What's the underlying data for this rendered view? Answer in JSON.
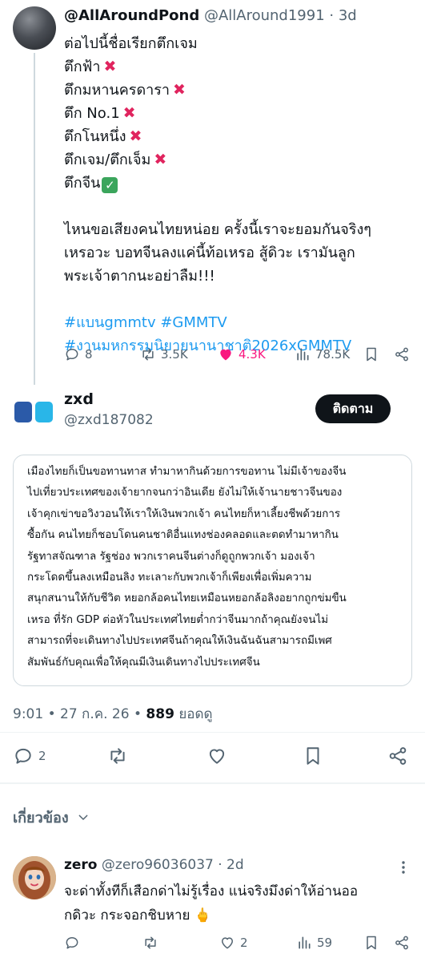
{
  "tweet1": {
    "display_name": "@AllAroundPond",
    "handle": "@AllAround1991",
    "time": "· 3d",
    "lines": [
      {
        "text": "ต่อไปนี้ชื่อเรียกตึกเจม",
        "mark": ""
      },
      {
        "text": "ตึกฟ้า",
        "mark": "x"
      },
      {
        "text": "ตึกมหานครดารา",
        "mark": "x"
      },
      {
        "text": "ตึก No.1",
        "mark": "x"
      },
      {
        "text": "ตึกโนหนึ่ง",
        "mark": "x"
      },
      {
        "text": "ตึกเจม/ตึกเจ็ม",
        "mark": "x"
      },
      {
        "text": "ตึกจีน",
        "mark": "check"
      }
    ],
    "paragraph": [
      "ไหนขอเสียงคนไทยหน่อย ครั้งนี้เราจะยอมกันจริงๆ",
      "เหรอวะ บอทจีนลงแค่นี้ท้อเหรอ สู้ดิวะ เรามันลูก",
      "พระเจ้าตากนะอย่าลืม!!!"
    ],
    "hashtags": [
      "#แบนgmmtv #GMMTV",
      "#งานมหกรรมนิยายนานาชาติ2026xGMMTV"
    ],
    "stats": {
      "replies": "8",
      "reposts": "3.5K",
      "likes": "4.3K",
      "views": "78.5K"
    },
    "colors": {
      "like": "#f91880",
      "hashtag": "#1d9bf0"
    }
  },
  "tweet2": {
    "display_name": "zxd",
    "handle": "@zxd187082",
    "follow_label": "ติดตาม",
    "quote_lines": [
      "เมืองไทยก็เป็นขอทานทาส ทำมาหากินด้วยการขอทาน ไม่มีเจ้าของจีน",
      "ไปเที่ยวประเทศของเจ้ายากจนกว่าอินเดีย ยังไม่ให้เจ้านายชาวจีนของ",
      "เจ้าคุกเข่าขอวิงวอนให้เราให้เงินพวกเจ้า คนไทยก็หาเลี้ยงชีพด้วยการ",
      "ซื้อกัน คนไทยก็ชอบโดนคนชาติอื่นแทงช่องคลอดและตดทำมาหากิน",
      "รัฐทาสจัณฑาล รัฐช่อง พวกเราคนจีนต่างก็ดูถูกพวกเจ้า มองเจ้า",
      "กระโดดขึ้นลงเหมือนลิง ทะเลาะกับพวกเจ้าก็เพียงเพื่อเพิ่มความ",
      "สนุกสนานให้กับชีวิต หยอกล้อคนไทยเหมือนหยอกล้อลิงอยากถูกข่มขืน",
      "เหรอ ที่รัก GDP ต่อหัวในประเทศไทยต่ำกว่าจีนมากถ้าคุณยังจนไม่",
      "สามารถที่จะเดินทางไปประเทศจีนถ้าคุณให้เงินฉันฉันสามารถมีเพศ",
      "สัมพันธ์กับคุณเพื่อให้คุณมีเงินเดินทางไปประเทศจีน"
    ],
    "timestamp": "9:01 • 27 ก.ค. 26 •",
    "views_count": "889",
    "views_label": "ยอดดู",
    "stats": {
      "replies": "2"
    }
  },
  "related": {
    "label": "เกี่ยวข้อง"
  },
  "reply": {
    "display_name": "zero",
    "handle": "@zero96036037",
    "time": "· 2d",
    "lines": [
      "จะด่าทั้งทีก็เสือกด่าไม่รู้เรื่อง แน่จริงมึงด่าให้อ่านออ",
      "กดิวะ กระจอกชิบหาย 🖕"
    ],
    "stats": {
      "likes": "2",
      "views": "59"
    }
  }
}
